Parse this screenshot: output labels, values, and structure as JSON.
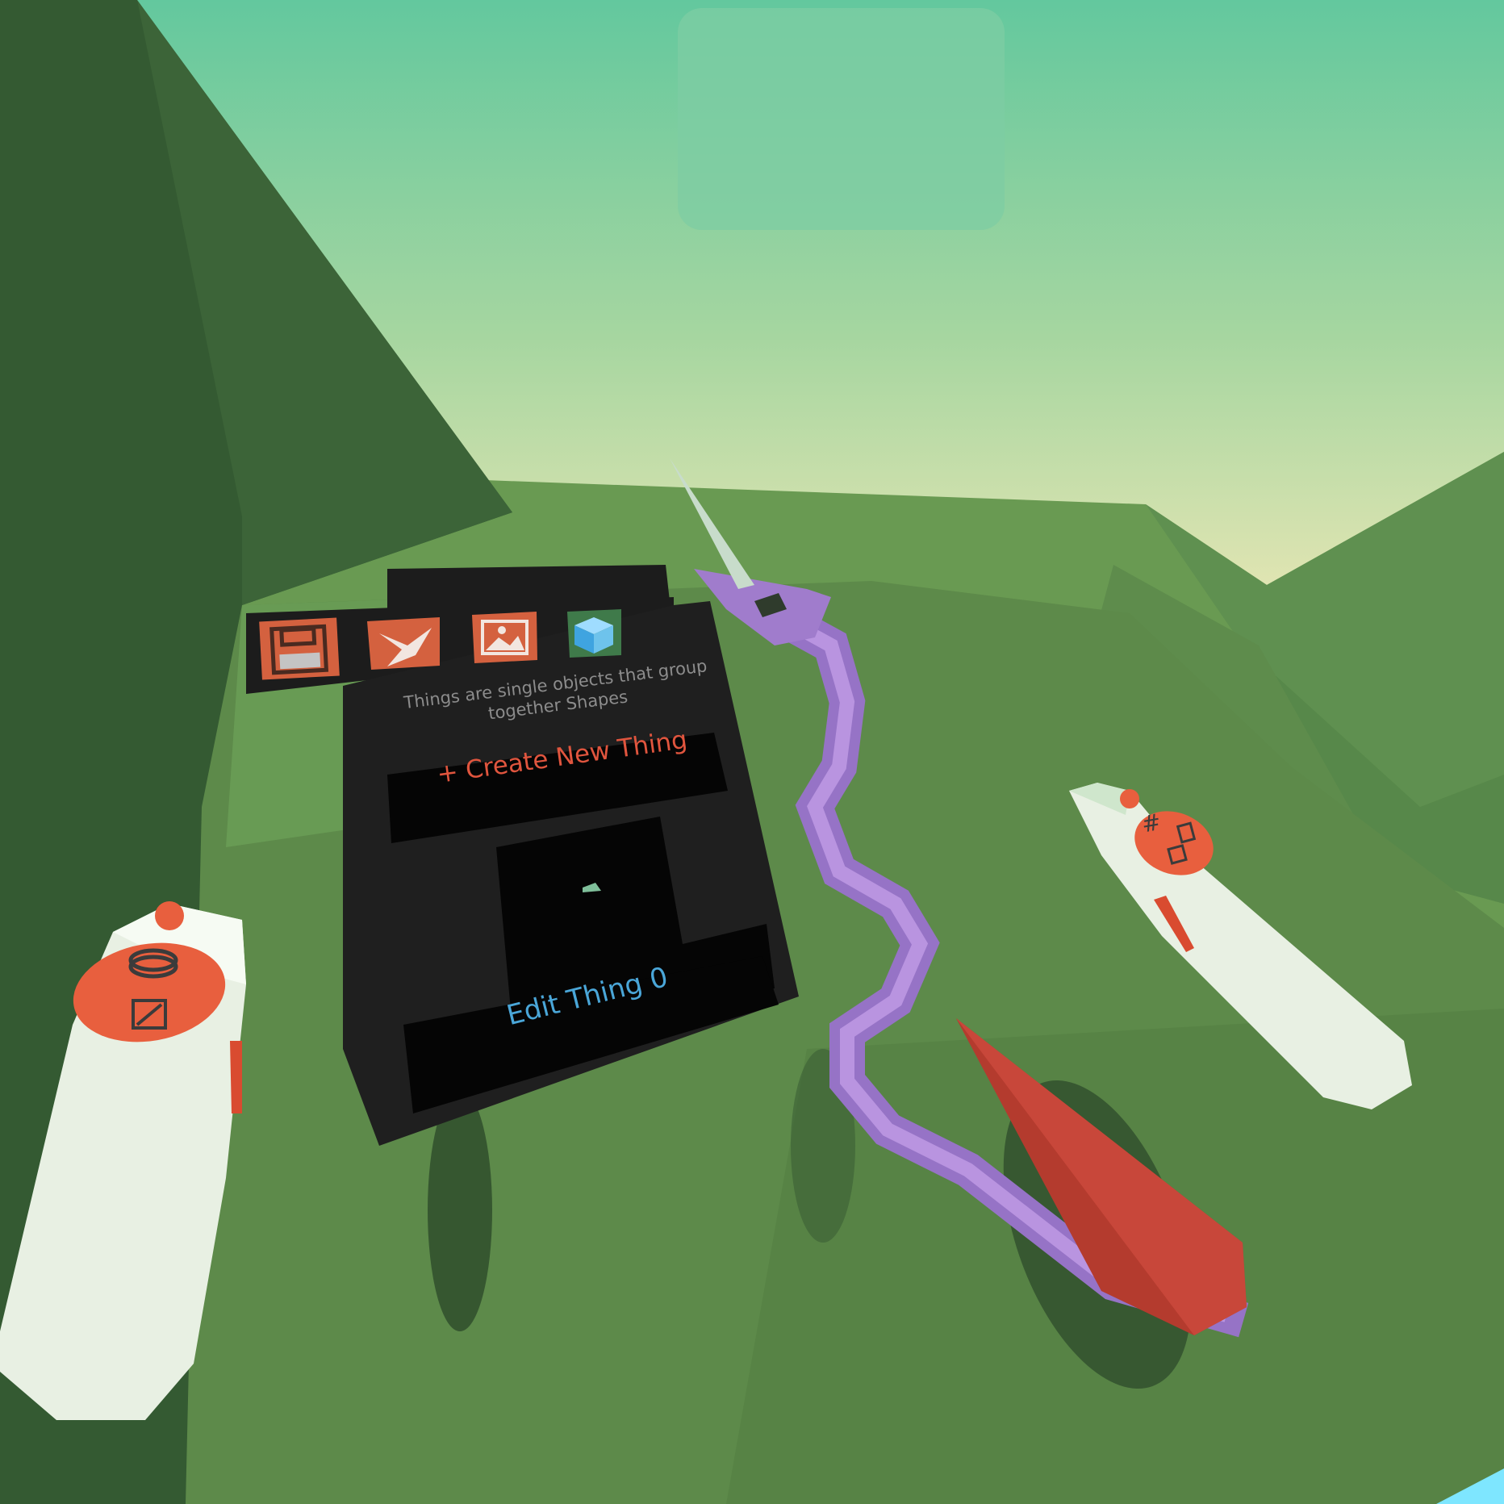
{
  "scene": {
    "sky_color_top": "#63c89e",
    "sky_color_horizon": "#e6e6b4",
    "ground_color": "#5d8a4a",
    "hill_color": "#345a32"
  },
  "panel": {
    "toolbar": {
      "items": [
        {
          "name": "save",
          "icon": "floppy-disk-icon",
          "color": "#d4613f"
        },
        {
          "name": "bird",
          "icon": "bird-icon",
          "color": "#d4613f"
        },
        {
          "name": "image",
          "icon": "image-icon",
          "color": "#d4613f"
        },
        {
          "name": "cube",
          "icon": "cube-icon",
          "color": "#6ec3ec"
        }
      ]
    },
    "description": "Things are single objects that group together Shapes",
    "create_button_label": "+ Create New Thing",
    "edit_button_label": "Edit Thing 0",
    "accent_orange": "#e0553e",
    "accent_blue": "#4aa6d8"
  },
  "controllers": {
    "left": {
      "icons": [
        "ring-icon",
        "resize-icon"
      ]
    },
    "right": {
      "icons": [
        "grid-icon",
        "trash-icon",
        "copy-icon"
      ]
    }
  }
}
